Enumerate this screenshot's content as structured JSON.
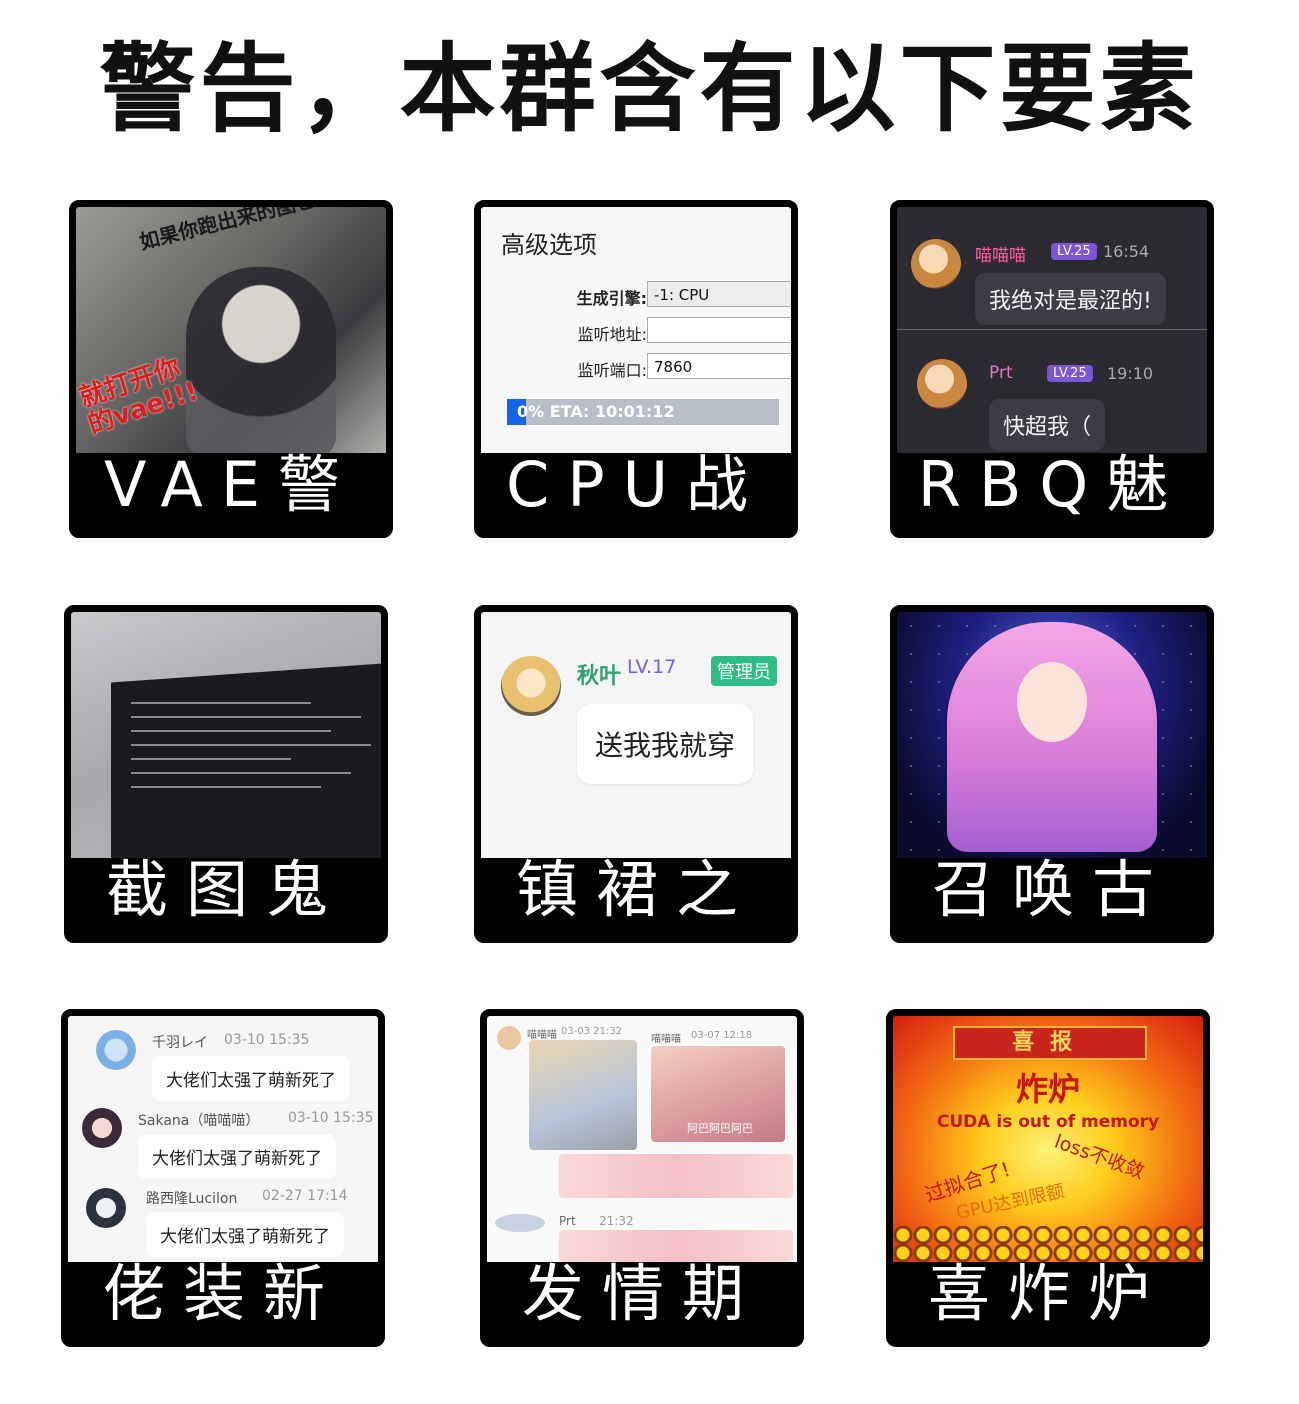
{
  "title": "警告，本群含有以下要素",
  "cards": [
    {
      "caption": "VAE警察",
      "shot": {
        "text": "如果你跑出来的图它像这样",
        "red_text": "就打开你\n的vae!!!"
      }
    },
    {
      "caption": "CPU战士",
      "shot": {
        "heading": "高级选项",
        "rows": [
          {
            "label": "生成引擎:",
            "value": "-1: CPU"
          },
          {
            "label": "监听地址:",
            "value": ""
          },
          {
            "label": "监听端口:",
            "value": "7860"
          }
        ],
        "progress_text": "0% ETA: 10:01:12",
        "progress": 0.07
      }
    },
    {
      "caption": "RBQ魅魔",
      "shot": {
        "messages": [
          {
            "name": "喵喵喵",
            "level": "LV.25",
            "time": "16:54",
            "text": "我绝对是最涩的!"
          },
          {
            "name": "Prt",
            "level": "LV.25",
            "time": "19:10",
            "text": "快超我（"
          }
        ]
      }
    },
    {
      "caption": "截图鬼才"
    },
    {
      "caption": "镇裙之宝",
      "shot": {
        "name": "秋叶",
        "level": "LV.17",
        "badge": "管理员",
        "text": "送我我就穿"
      }
    },
    {
      "caption": "召唤古神"
    },
    {
      "caption": "佬装新",
      "shot": {
        "messages": [
          {
            "name": "千羽レイ",
            "time": "03-10 15:35",
            "text": "大佬们太强了萌新死了"
          },
          {
            "name": "Sakana（喵喵喵）",
            "time": "03-10 15:35",
            "text": "大佬们太强了萌新死了"
          },
          {
            "name": "路西隆Lucilon",
            "time": "02-27 17:14",
            "text": "大佬们太强了萌新死了"
          }
        ]
      }
    },
    {
      "caption": "发情期",
      "shot": {
        "msgs": [
          {
            "name": "喵喵喵",
            "time": "03-03 21:32"
          },
          {
            "name": "喵喵喵",
            "time": "03-07 12:18"
          },
          {
            "name": "Prt",
            "time": "21:32"
          }
        ],
        "image_caption": "阿巴阿巴阿巴"
      }
    },
    {
      "caption": "喜炸炉",
      "shot": {
        "banner": "喜报",
        "headline": "炸炉",
        "line1": "CUDA is out of memory",
        "line2": "过拟合了!",
        "line3": "loss不收敛",
        "line4": "GPU达到限额"
      }
    }
  ]
}
